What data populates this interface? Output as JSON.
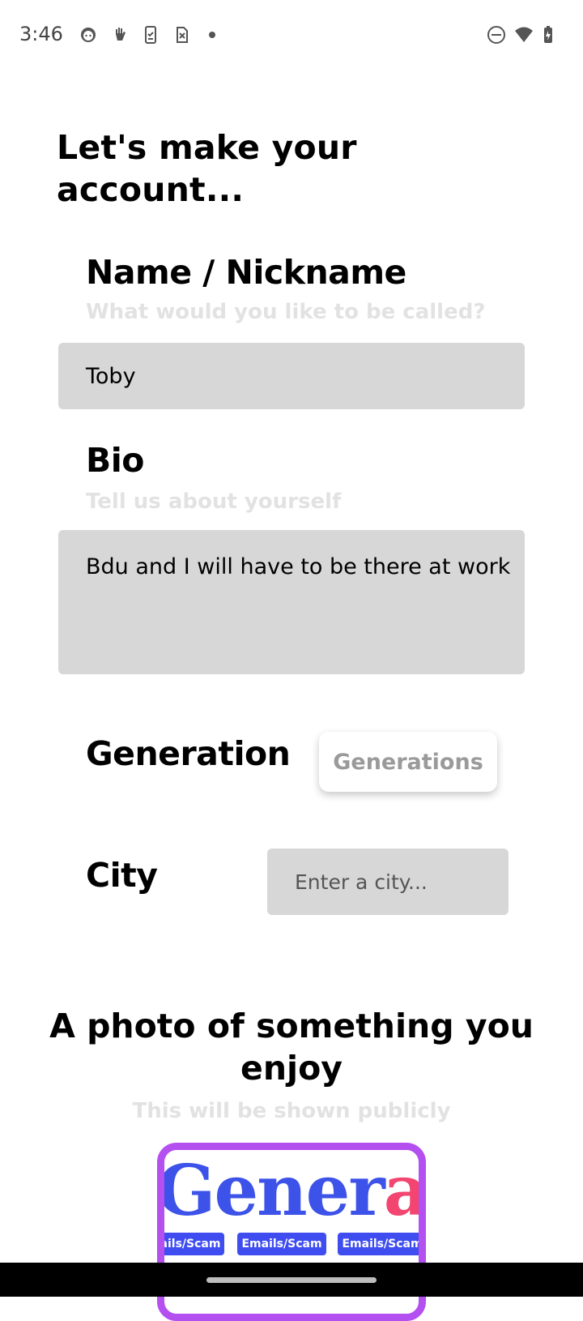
{
  "status_bar": {
    "time": "3:46",
    "icons": [
      "face-icon",
      "hand-icon",
      "phone-check-icon",
      "sim-icon",
      "dot-icon",
      "dnd-icon",
      "wifi-icon",
      "battery-icon"
    ]
  },
  "page": {
    "title": "Let's make your account..."
  },
  "name_section": {
    "label": "Name / Nickname",
    "hint": "What would you like to be called?",
    "value": "Toby"
  },
  "bio_section": {
    "label": "Bio",
    "hint": "Tell us about yourself",
    "value": "Bdu and I will have to be there at work"
  },
  "generation_section": {
    "label": "Generation",
    "button_label": "Generations"
  },
  "city_section": {
    "label": "City",
    "placeholder": "Enter a city..."
  },
  "photo_section": {
    "title": "A photo of something you enjoy",
    "hint": "This will be shown publicly",
    "image_text_part1": "Gener",
    "image_text_part2": "aic",
    "chips": [
      "ails/Scam",
      "Emails/Scam",
      "Emails/Scam"
    ]
  },
  "colors": {
    "field_bg": "#d7d7d7",
    "hint": "#e2e2e2",
    "frame": "#b44ff0",
    "brand_blue": "#3c52e8",
    "brand_pink": "#f2456f"
  }
}
